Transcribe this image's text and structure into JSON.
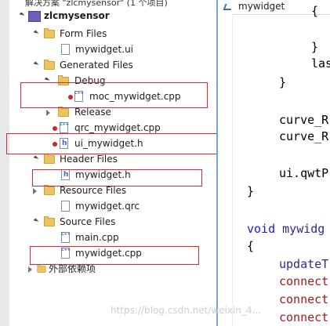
{
  "solution_bar": {
    "text": "解决方案 \"zlcmysensor\" (1 个项目)"
  },
  "tree": [
    {
      "label": "zlcmysensor",
      "kind": "project"
    },
    {
      "label": "Form Files",
      "kind": "folder"
    },
    {
      "label": "mywidget.ui",
      "kind": "file-ui"
    },
    {
      "label": "Generated Files",
      "kind": "folder"
    },
    {
      "label": "Debug",
      "kind": "folder"
    },
    {
      "label": "moc_mywidget.cpp",
      "kind": "file-cpp"
    },
    {
      "label": "Release",
      "kind": "folder"
    },
    {
      "label": "qrc_mywidget.cpp",
      "kind": "file-cpp"
    },
    {
      "label": "ui_mywidget.h",
      "kind": "file-h"
    },
    {
      "label": "Header Files",
      "kind": "folder"
    },
    {
      "label": "mywidget.h",
      "kind": "file-h"
    },
    {
      "label": "Resource Files",
      "kind": "folder"
    },
    {
      "label": "mywidget.qrc",
      "kind": "file"
    },
    {
      "label": "Source Files",
      "kind": "folder"
    },
    {
      "label": "main.cpp",
      "kind": "file-cpp"
    },
    {
      "label": "mywidget.cpp",
      "kind": "file-cpp"
    },
    {
      "label": "外部依赖项",
      "kind": "folder"
    }
  ],
  "editor": {
    "tab_label": "mywidget",
    "lines": [
      "{",
      "}",
      "las",
      "}",
      "curve_R",
      "curve_R",
      "ui.qwtP",
      "}",
      "void mywidg",
      "{",
      "updateT",
      "connect",
      "connect",
      "connect"
    ],
    "void_kw": "void",
    "void_rest": " mywidg"
  },
  "watermark": "https://blog.csdn.net/weixin_4..."
}
